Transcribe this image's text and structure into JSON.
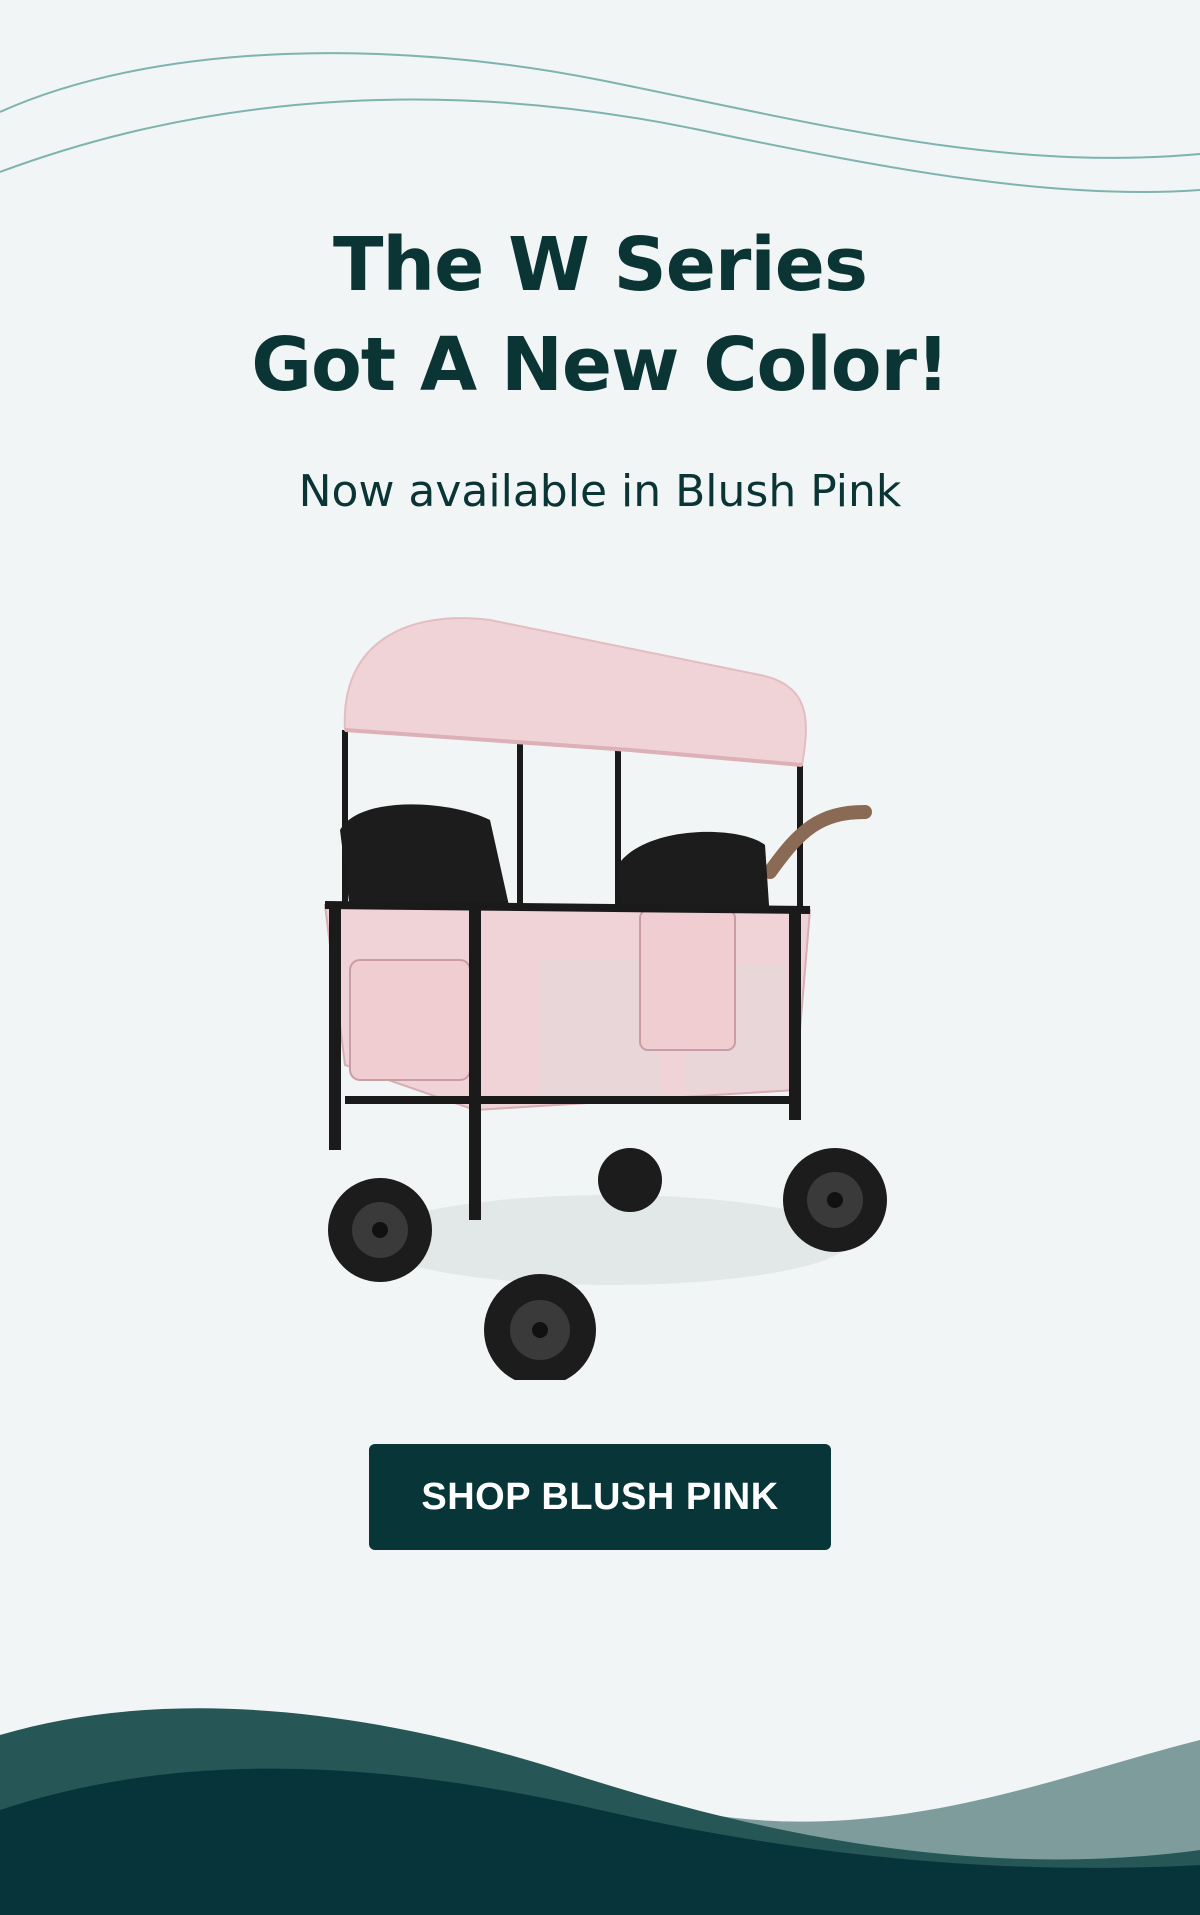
{
  "header": {
    "title_line_1": "The W Series",
    "title_line_2": "Got A New Color!",
    "subtitle": "Now available in Blush Pink"
  },
  "product": {
    "image_name": "blush-pink-wagon-stroller",
    "color": "#f0d3d6"
  },
  "cta": {
    "label": "SHOP BLUSH PINK"
  },
  "colors": {
    "background": "#f1f5f5",
    "text": "#0b3535",
    "button": "#083638",
    "wave_line": "#7fb3ad",
    "footer_dark": "#07343a",
    "footer_mid": "#275656",
    "footer_light": "#7e9c9c"
  }
}
